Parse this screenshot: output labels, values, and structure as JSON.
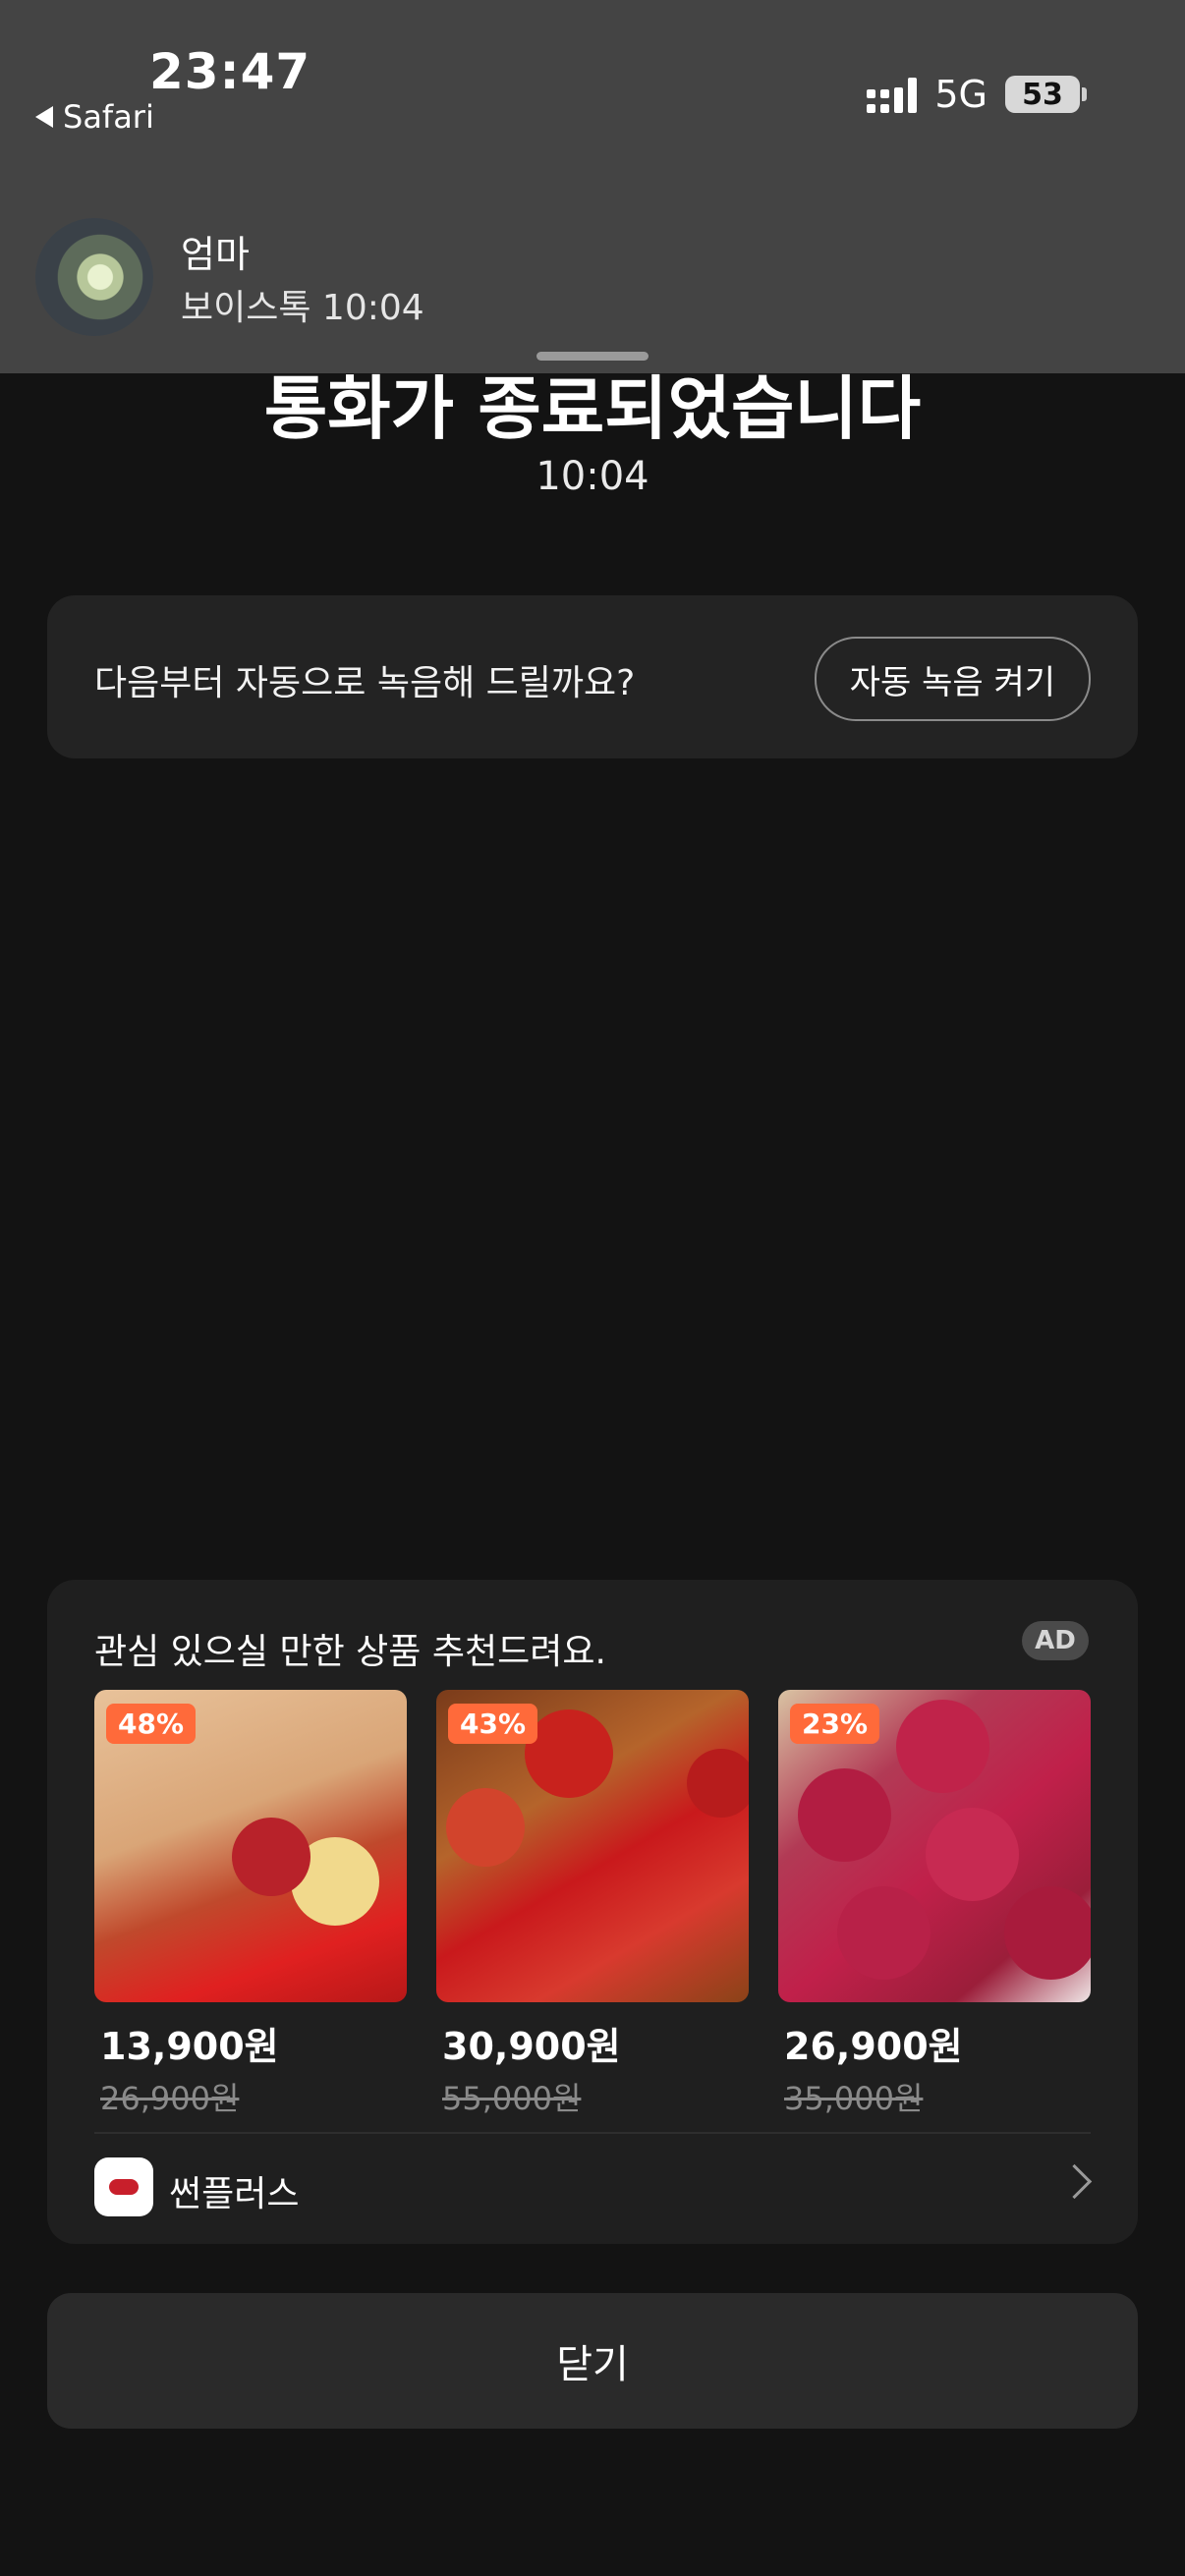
{
  "status_bar": {
    "time": "23:47",
    "back_label": "Safari",
    "network": "5G",
    "battery": "53"
  },
  "notification": {
    "title": "엄마",
    "subtitle": "보이스톡 10:04"
  },
  "call": {
    "ended_title": "통화가 종료되었습니다",
    "duration": "10:04"
  },
  "auto_record": {
    "prompt": "다음부터 자동으로 녹음해 드릴까요?",
    "button_label": "자동 녹음 켜기"
  },
  "ad": {
    "heading": "관심 있으실 만한 상품 추천드려요.",
    "badge": "AD",
    "products": [
      {
        "discount": "48%",
        "price": "13,900원",
        "original_price": "26,900원"
      },
      {
        "discount": "43%",
        "price": "30,900원",
        "original_price": "55,000원"
      },
      {
        "discount": "23%",
        "price": "26,900원",
        "original_price": "35,000원"
      }
    ],
    "seller_name": "썬플러스"
  },
  "close_label": "닫기",
  "colors": {
    "background": "#131313",
    "banner": "#444444",
    "card": "#1f1f1f",
    "discount_badge": "#ff6a3a"
  }
}
